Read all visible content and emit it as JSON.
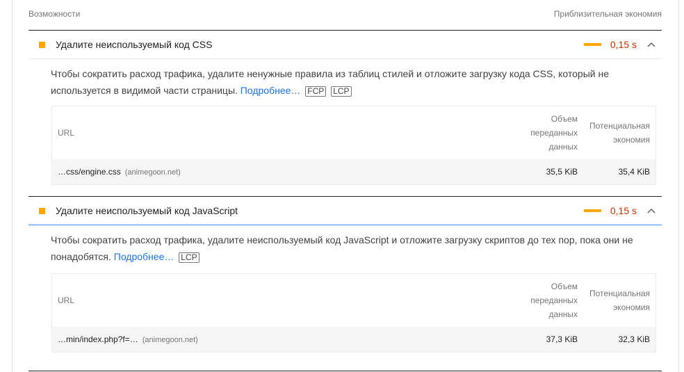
{
  "header": {
    "left": "Возможности",
    "right": "Приблизительная экономия"
  },
  "audits": [
    {
      "title": "Удалите неиспользуемый код CSS",
      "savings": "0,15 s",
      "desc_text": "Чтобы сократить расход трафика, удалите ненужные правила из таблиц стилей и отложите загрузку кода CSS, который не используется в видимой части страницы.",
      "learn_more": "Подробнее…",
      "badges": [
        "FCP",
        "LCP"
      ],
      "table": {
        "col_url": "URL",
        "col_transfer": "Объем переданных данных",
        "col_savings": "Потенциальная экономия",
        "rows": [
          {
            "url": "…css/engine.css",
            "host": "(animegoon.net)",
            "transfer": "35,5 KiB",
            "savings": "35,4 KiB"
          }
        ]
      }
    },
    {
      "title": "Удалите неиспользуемый код JavaScript",
      "savings": "0,15 s",
      "desc_text": "Чтобы сократить расход трафика, удалите неиспользуемый код JavaScript и отложите загрузку скриптов до тех пор, пока они не понадобятся.",
      "learn_more": "Подробнее…",
      "badges": [
        "LCP"
      ],
      "table": {
        "col_url": "URL",
        "col_transfer": "Объем переданных данных",
        "col_savings": "Потенциальная экономия",
        "rows": [
          {
            "url": "…min/index.php?f=…",
            "host": "(animegoon.net)",
            "transfer": "37,3 KiB",
            "savings": "32,3 KiB"
          }
        ]
      }
    }
  ],
  "colors": {
    "warn": "#ffa400",
    "savings_text": "#c33300",
    "link": "#1a73e8"
  }
}
